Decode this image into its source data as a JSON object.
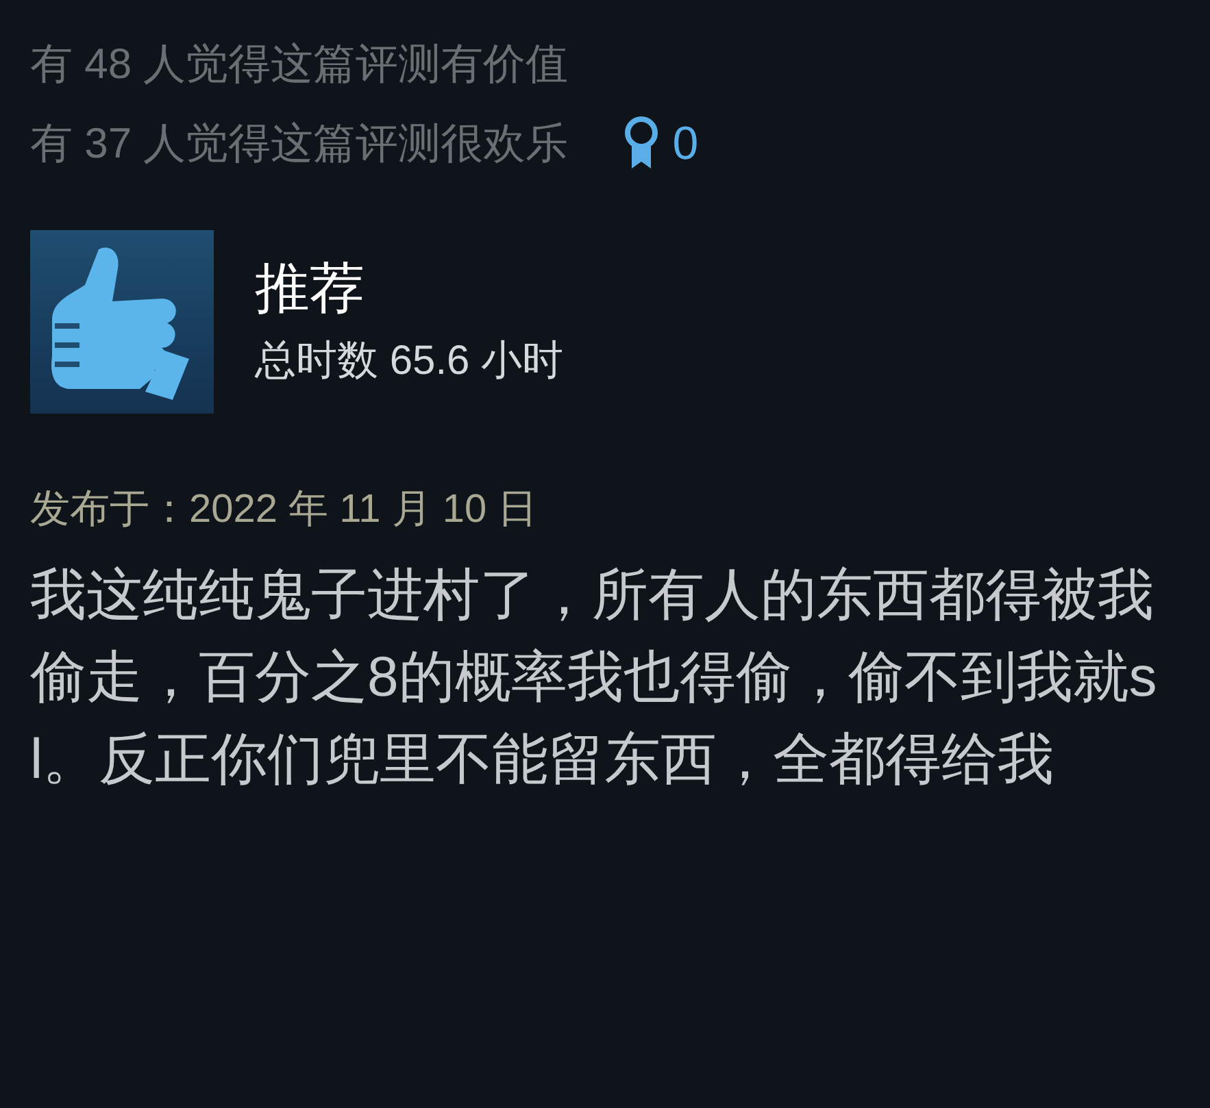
{
  "votes": [
    {
      "text": "有 48 人觉得这篇评测有价值"
    },
    {
      "text": "有 37 人觉得这篇评测很欢乐"
    }
  ],
  "award_count": "0",
  "review": {
    "verdict": "推荐",
    "recommended": true,
    "hours": "总时数 65.6 小时",
    "posted": "发布于：2022 年 11 月 10 日",
    "body": "我这纯纯鬼子进村了，所有人的东西都得被我偷走，百分之8的概率我也得偷，偷不到我就sl。反正你们兜里不能留东西，全都得给我"
  }
}
